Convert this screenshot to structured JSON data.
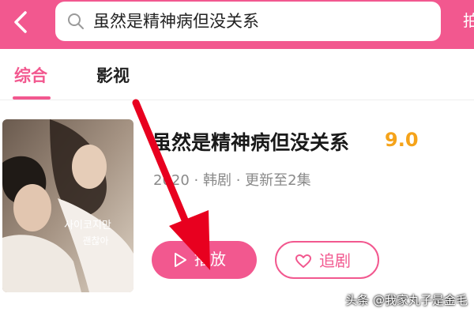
{
  "search": {
    "query": "虽然是精神病但没关系"
  },
  "topbar": {
    "cut_text": "拍"
  },
  "tabs": [
    {
      "label": "综合",
      "active": true
    },
    {
      "label": "影视",
      "active": false
    }
  ],
  "result": {
    "title": "虽然是精神病但没关系",
    "rating": "9.0",
    "meta": "2020 · 韩剧 · 更新至2集",
    "poster_text": "사이코지만 괜찮아"
  },
  "buttons": {
    "play_label": "播放",
    "follow_label": "追剧"
  },
  "watermark": "头条 @我家丸子是金毛",
  "colors": {
    "brand": "#f2588f",
    "rating": "#f5a31a",
    "annotation_arrow": "#e8001f"
  },
  "icons": {
    "back": "chevron-left-icon",
    "search": "search-icon",
    "play": "play-icon",
    "follow": "heart-icon"
  }
}
